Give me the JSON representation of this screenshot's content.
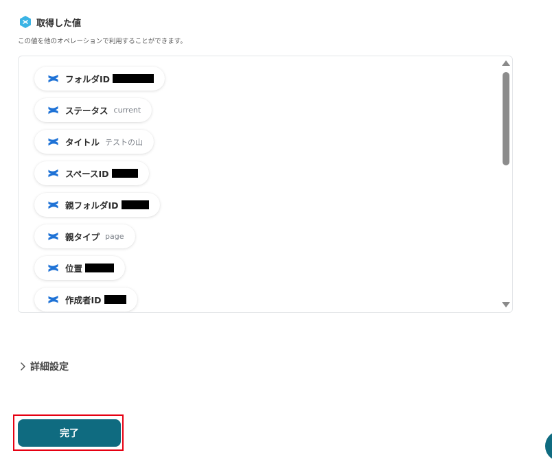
{
  "section": {
    "title": "取得した値",
    "description": "この値を他のオペレーションで利用することができます。"
  },
  "values": [
    {
      "label": "フォルダID",
      "value": "",
      "redacted": true
    },
    {
      "label": "ステータス",
      "value": "current",
      "redacted": false
    },
    {
      "label": "タイトル",
      "value": "テストの山",
      "redacted": false
    },
    {
      "label": "スペースID",
      "value": "",
      "redacted": true
    },
    {
      "label": "親フォルダID",
      "value": "",
      "redacted": true
    },
    {
      "label": "親タイプ",
      "value": "page",
      "redacted": false
    },
    {
      "label": "位置",
      "value": "",
      "redacted": true
    },
    {
      "label": "作成者ID",
      "value": "",
      "redacted": true
    }
  ],
  "advanced": {
    "label": "詳細設定"
  },
  "complete_button": {
    "label": "完了"
  },
  "colors": {
    "accent": "#0f6b80",
    "highlight": "#e60012",
    "app_icon": "#1e72d6",
    "header_icon": "#3bb4e5"
  }
}
